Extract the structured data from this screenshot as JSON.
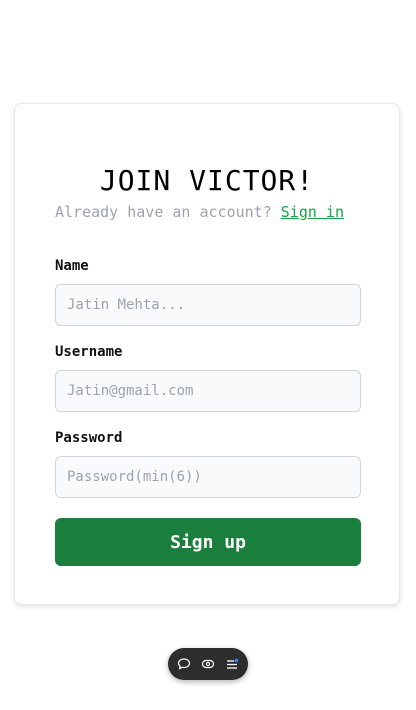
{
  "signup": {
    "title": "JOIN VICTOR!",
    "subtitle_text": "Already have an account?",
    "signin_link": "Sign in",
    "fields": {
      "name": {
        "label": "Name",
        "placeholder": "Jatin Mehta...",
        "value": ""
      },
      "username": {
        "label": "Username",
        "placeholder": "Jatin@gmail.com",
        "value": ""
      },
      "password": {
        "label": "Password",
        "placeholder": "Password(min(6))",
        "value": ""
      }
    },
    "submit_label": "Sign up"
  },
  "toolbar": {
    "icons": [
      "chat-icon",
      "eye-icon",
      "menu-list-icon"
    ]
  },
  "colors": {
    "accent": "#1a7f3c",
    "link": "#16a34a",
    "muted_text": "#9ca3af",
    "input_bg": "#f9fafb",
    "toolbar_bg": "#2d2d2d"
  }
}
